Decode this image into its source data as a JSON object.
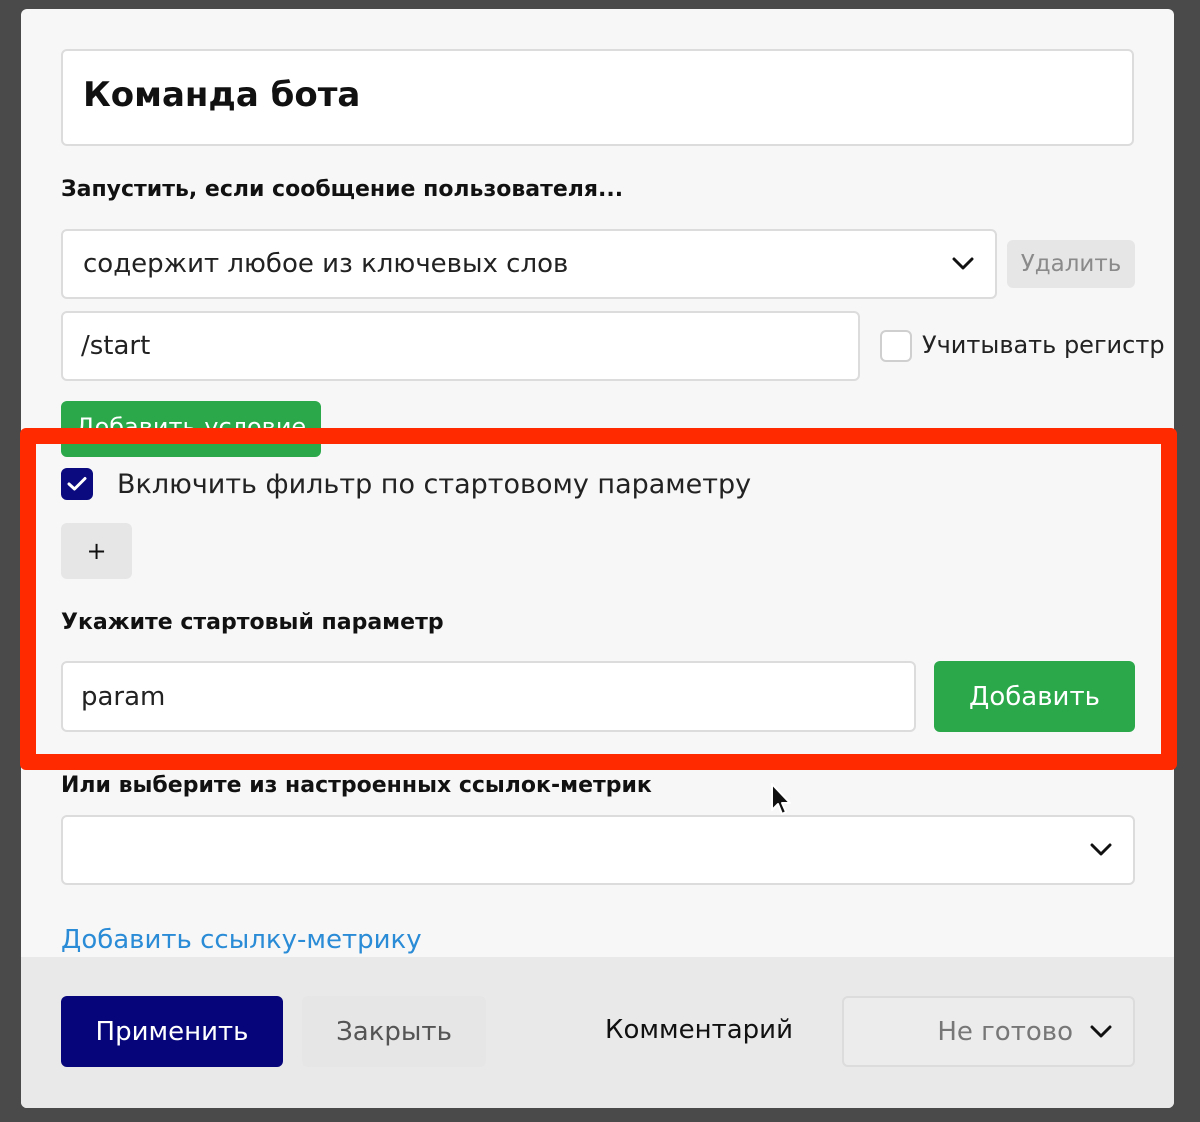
{
  "dialog": {
    "title": "Команда бота",
    "trigger_label": "Запустить, если сообщение пользователя...",
    "condition_select": "содержит любое из ключевых слов",
    "delete_button": "Удалить",
    "keyword_value": "/start",
    "case_sensitive_label": "Учитывать регистр",
    "add_condition_button": "Добавить условие",
    "start_filter_label": "Включить фильтр по стартовому параметру",
    "plus_button": "+",
    "start_param_label": "Укажите стартовый параметр",
    "start_param_value": "param",
    "add_button": "Добавить",
    "metric_label": "Или выберите из настроенных ссылок-метрик",
    "metric_select": "",
    "add_metric_link": "Добавить ссылку-метрику"
  },
  "footer": {
    "apply_button": "Применить",
    "close_button": "Закрыть",
    "comment_button": "Комментарий",
    "status_select": "Не готово"
  },
  "colors": {
    "primary": "#06057a",
    "green": "#2aa84a",
    "highlight": "#ff2a00",
    "link": "#2a8bd6"
  }
}
